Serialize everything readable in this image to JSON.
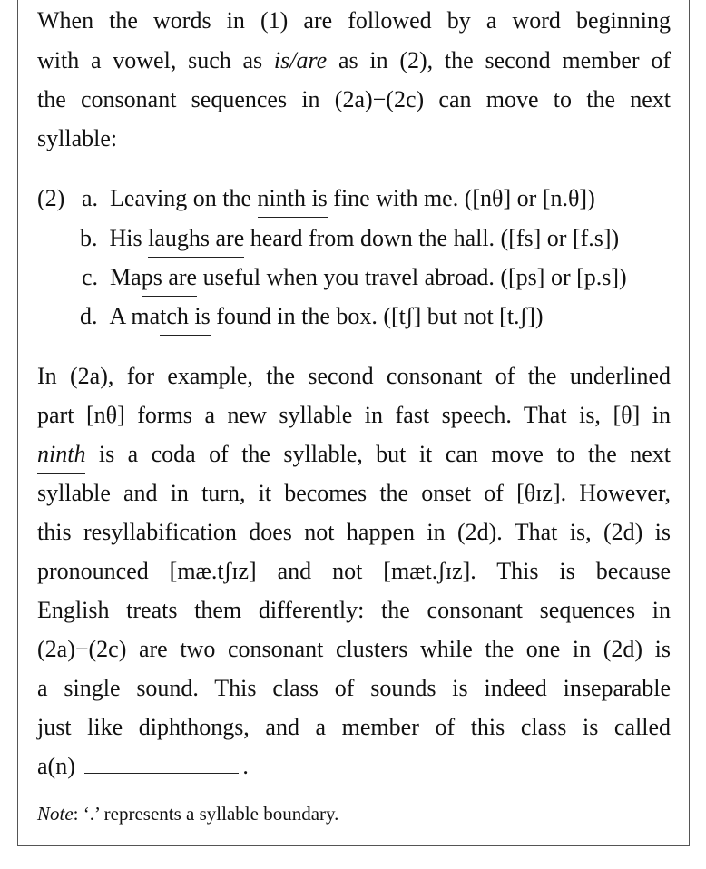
{
  "intro": {
    "l1": "When the words in (1) are followed by a word beginning",
    "l2_a": "with a vowel, such as ",
    "l2_em": "is/are",
    "l2_b": " as in (2), the second member of",
    "l3": "the consonant sequences in (2a)−(2c) can move to the next",
    "l4": "syllable:"
  },
  "examples": {
    "number": "(2)",
    "a": {
      "label": "a.",
      "pre": "Leaving on the ",
      "u": "ninth is",
      "post": " fine with me. ([nθ] or [n.θ])"
    },
    "b": {
      "label": "b.",
      "pre": "His ",
      "u": "laughs are",
      "post": " heard from down the hall. ([fs] or [f.s])"
    },
    "c": {
      "label": "c.",
      "pre": "Ma",
      "u": "ps are",
      "post": " useful when you travel abroad. ([ps] or [p.s])"
    },
    "d": {
      "label": "d.",
      "pre": "A ma",
      "u": "tch is",
      "post": " found in the box. ([tʃ] but not [t.ʃ])"
    }
  },
  "para": {
    "l1": "In (2a), for example, the second consonant of the underlined",
    "l2": "part [nθ] forms a new syllable in fast speech. That is, [θ] in",
    "l3_em": "ninth",
    "l3_b": " is a coda of the syllable, but it can move to the next",
    "l4": "syllable and in turn, it becomes the onset of [θɪz]. However,",
    "l5": "this resyllabification does not happen in (2d). That is, (2d) is",
    "l6": "pronounced [mæ.tʃɪz] and not [mæt.ʃɪz]. This is because",
    "l7": "English treats them differently: the consonant sequences in",
    "l8": "(2a)−(2c) are two consonant clusters while the one in (2d) is",
    "l9": "a single sound. This class of sounds is indeed inseparable",
    "l10": "just like diphthongs, and a member of this class is called",
    "l11": "a(n)",
    "l11_end": "."
  },
  "note": {
    "label": "Note",
    "text": ": ‘.’ represents a syllable boundary."
  }
}
